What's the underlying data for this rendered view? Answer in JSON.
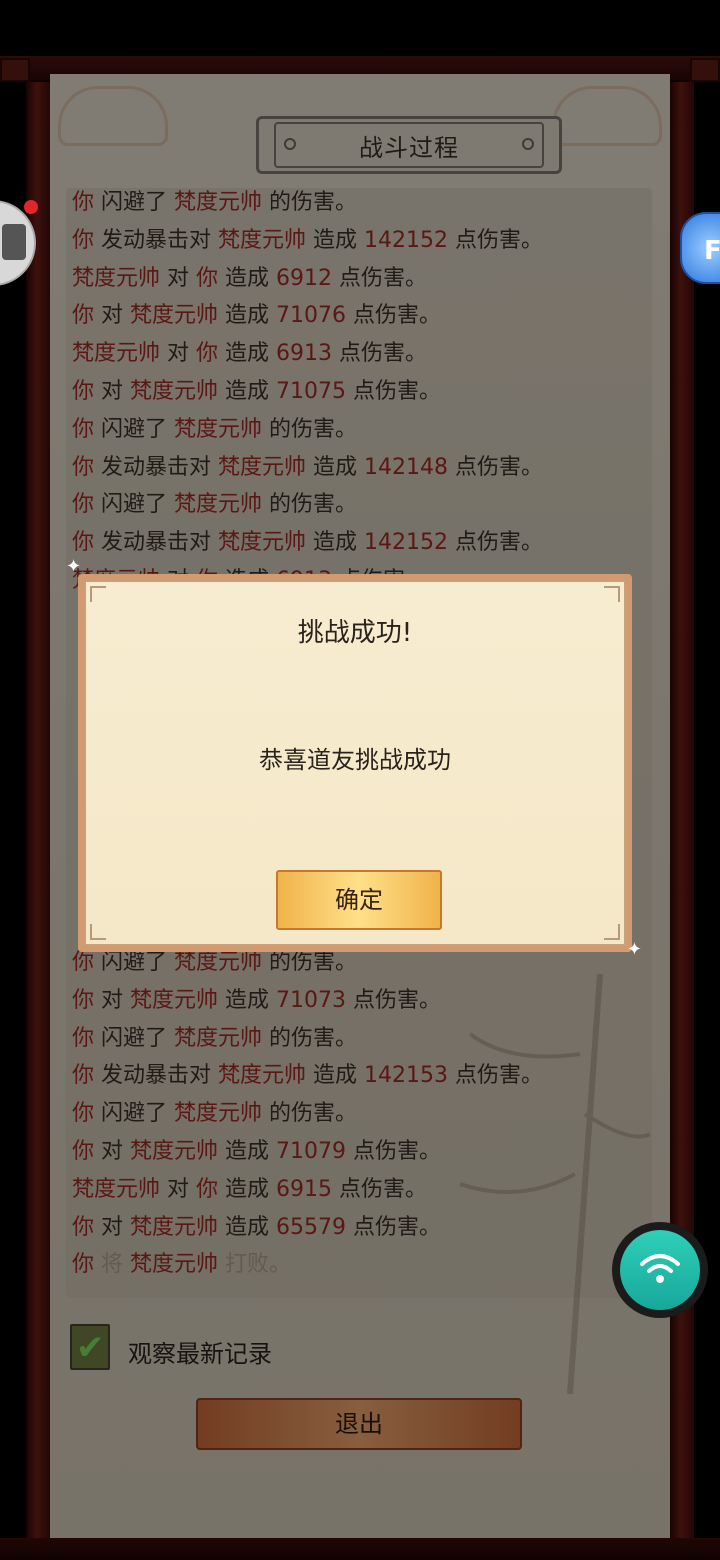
{
  "panel": {
    "title": "战斗过程",
    "observe_label": "观察最新记录",
    "observe_checked": true,
    "exit_label": "退出"
  },
  "battle_log_top": [
    [
      [
        "你",
        "hl"
      ],
      [
        " 闪避了 ",
        ""
      ],
      [
        "梵度元帅",
        "hl"
      ],
      [
        " 的伤害。",
        ""
      ]
    ],
    [
      [
        "你",
        "hl"
      ],
      [
        " 发动暴击对 ",
        ""
      ],
      [
        "梵度元帅",
        "hl"
      ],
      [
        " 造成 ",
        ""
      ],
      [
        "142152",
        "num"
      ],
      [
        " 点伤害。",
        ""
      ]
    ],
    [
      [
        "梵度元帅",
        "hl"
      ],
      [
        " 对 ",
        ""
      ],
      [
        "你",
        "hl"
      ],
      [
        " 造成 ",
        ""
      ],
      [
        "6912",
        "num"
      ],
      [
        " 点伤害。",
        ""
      ]
    ],
    [
      [
        "你",
        "hl"
      ],
      [
        " 对 ",
        ""
      ],
      [
        "梵度元帅",
        "hl"
      ],
      [
        " 造成 ",
        ""
      ],
      [
        "71076",
        "num"
      ],
      [
        " 点伤害。",
        ""
      ]
    ],
    [
      [
        "梵度元帅",
        "hl"
      ],
      [
        " 对 ",
        ""
      ],
      [
        "你",
        "hl"
      ],
      [
        " 造成 ",
        ""
      ],
      [
        "6913",
        "num"
      ],
      [
        " 点伤害。",
        ""
      ]
    ],
    [
      [
        "你",
        "hl"
      ],
      [
        " 对 ",
        ""
      ],
      [
        "梵度元帅",
        "hl"
      ],
      [
        " 造成 ",
        ""
      ],
      [
        "71075",
        "num"
      ],
      [
        " 点伤害。",
        ""
      ]
    ],
    [
      [
        "你",
        "hl"
      ],
      [
        " 闪避了 ",
        ""
      ],
      [
        "梵度元帅",
        "hl"
      ],
      [
        " 的伤害。",
        ""
      ]
    ],
    [
      [
        "你",
        "hl"
      ],
      [
        " 发动暴击对 ",
        ""
      ],
      [
        "梵度元帅",
        "hl"
      ],
      [
        " 造成 ",
        ""
      ],
      [
        "142148",
        "num"
      ],
      [
        " 点伤害。",
        ""
      ]
    ],
    [
      [
        "你",
        "hl"
      ],
      [
        " 闪避了 ",
        ""
      ],
      [
        "梵度元帅",
        "hl"
      ],
      [
        " 的伤害。",
        ""
      ]
    ],
    [
      [
        "你",
        "hl"
      ],
      [
        " 发动暴击对 ",
        ""
      ],
      [
        "梵度元帅",
        "hl"
      ],
      [
        " 造成 ",
        ""
      ],
      [
        "142152",
        "num"
      ],
      [
        " 点伤害。",
        ""
      ]
    ],
    [
      [
        "梵度元帅",
        "hl"
      ],
      [
        " 对 ",
        ""
      ],
      [
        "你",
        "hl"
      ],
      [
        " 造成 ",
        ""
      ],
      [
        "6913",
        "num"
      ],
      [
        " 点伤害。",
        ""
      ]
    ]
  ],
  "battle_log_bottom": [
    [
      [
        "你",
        "hl"
      ],
      [
        " 闪避了 ",
        ""
      ],
      [
        "梵度元帅",
        "hl"
      ],
      [
        " 的伤害。",
        ""
      ]
    ],
    [
      [
        "你",
        "hl"
      ],
      [
        " 对 ",
        ""
      ],
      [
        "梵度元帅",
        "hl"
      ],
      [
        " 造成 ",
        ""
      ],
      [
        "71073",
        "num"
      ],
      [
        " 点伤害。",
        ""
      ]
    ],
    [
      [
        "你",
        "hl"
      ],
      [
        " 闪避了 ",
        ""
      ],
      [
        "梵度元帅",
        "hl"
      ],
      [
        " 的伤害。",
        ""
      ]
    ],
    [
      [
        "你",
        "hl"
      ],
      [
        " 发动暴击对 ",
        ""
      ],
      [
        "梵度元帅",
        "hl"
      ],
      [
        " 造成 ",
        ""
      ],
      [
        "142153",
        "num"
      ],
      [
        " 点伤害。",
        ""
      ]
    ],
    [
      [
        "你",
        "hl"
      ],
      [
        " 闪避了 ",
        ""
      ],
      [
        "梵度元帅",
        "hl"
      ],
      [
        " 的伤害。",
        ""
      ]
    ],
    [
      [
        "你",
        "hl"
      ],
      [
        " 对 ",
        ""
      ],
      [
        "梵度元帅",
        "hl"
      ],
      [
        " 造成 ",
        ""
      ],
      [
        "71079",
        "num"
      ],
      [
        " 点伤害。",
        ""
      ]
    ],
    [
      [
        "梵度元帅",
        "hl"
      ],
      [
        " 对 ",
        ""
      ],
      [
        "你",
        "hl"
      ],
      [
        " 造成 ",
        ""
      ],
      [
        "6915",
        "num"
      ],
      [
        " 点伤害。",
        ""
      ]
    ],
    [
      [
        "你",
        "hl"
      ],
      [
        " 对 ",
        ""
      ],
      [
        "梵度元帅",
        "hl"
      ],
      [
        " 造成 ",
        ""
      ],
      [
        "65579",
        "num"
      ],
      [
        " 点伤害。",
        ""
      ]
    ],
    [
      [
        "你",
        "hl"
      ],
      [
        " 将 ",
        "faded"
      ],
      [
        "梵度元帅",
        "hl"
      ],
      [
        " 打败。",
        "faded"
      ]
    ]
  ],
  "dialog": {
    "title": "挑战成功!",
    "message": "恭喜道友挑战成功",
    "confirm_label": "确定"
  },
  "floating": {
    "left_icon": "assistant-icon",
    "right_icon": "mascot-icon",
    "right_glyph": "F",
    "wifi_icon": "wifi-icon"
  },
  "colors": {
    "highlight_red": "#9b2a24",
    "paper": "#d5cdbd",
    "frame_red": "#5a1b16",
    "button_gold": "#ffe08a",
    "wifi_teal": "#1fbfa8"
  }
}
